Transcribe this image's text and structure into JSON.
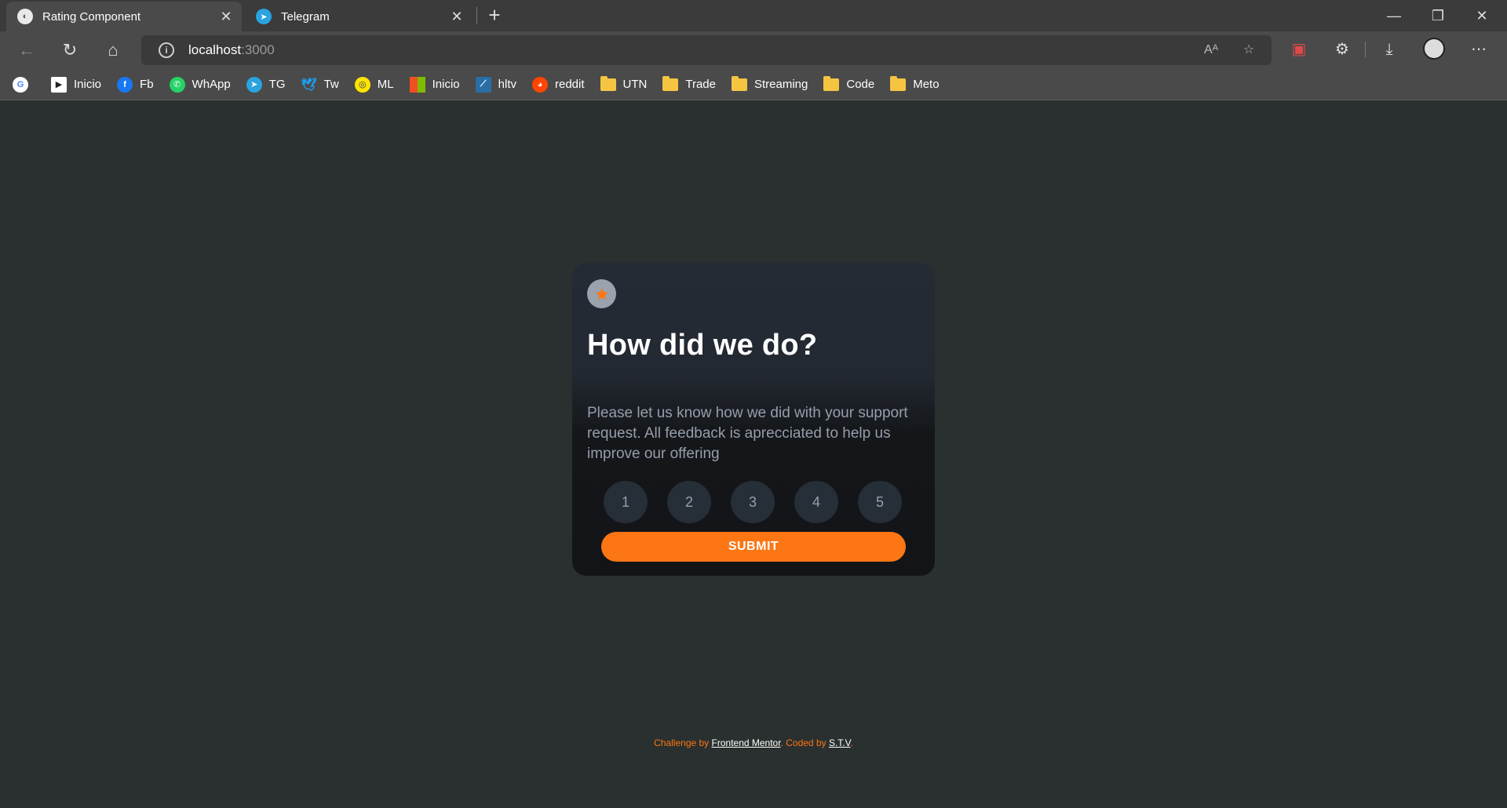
{
  "browser": {
    "tabs": [
      {
        "label": "Rating Component",
        "icon": "globe-icon",
        "active": true
      },
      {
        "label": "Telegram",
        "icon": "telegram-icon",
        "active": false
      }
    ],
    "address": {
      "host": "localhost",
      "port": ":3000"
    },
    "bookmarks": [
      {
        "label": "",
        "icon": "google-icon"
      },
      {
        "label": "Inicio",
        "icon": "play-icon"
      },
      {
        "label": "Fb",
        "icon": "facebook-icon"
      },
      {
        "label": "WhApp",
        "icon": "whatsapp-icon"
      },
      {
        "label": "TG",
        "icon": "telegram-icon"
      },
      {
        "label": "Tw",
        "icon": "twitter-icon"
      },
      {
        "label": "ML",
        "icon": "mercadolibre-icon"
      },
      {
        "label": "Inicio",
        "icon": "microsoft-icon"
      },
      {
        "label": "hltv",
        "icon": "hltv-icon"
      },
      {
        "label": "reddit",
        "icon": "reddit-icon"
      },
      {
        "label": "UTN",
        "icon": "folder-icon"
      },
      {
        "label": "Trade",
        "icon": "folder-icon"
      },
      {
        "label": "Streaming",
        "icon": "folder-icon"
      },
      {
        "label": "Code",
        "icon": "folder-icon"
      },
      {
        "label": "Meto",
        "icon": "folder-icon"
      }
    ]
  },
  "card": {
    "title": "How did we do?",
    "description": "Please let us know how we did with your support request. All feedback is aprecciated to help us improve our offering",
    "ratings": [
      "1",
      "2",
      "3",
      "4",
      "5"
    ],
    "submit_label": "SUBMIT"
  },
  "footer": {
    "challenge_prefix": "Challenge by ",
    "challenge_link": "Frontend Mentor",
    "coded_prefix": ". Coded by ",
    "coded_link": "S.T.V",
    "suffix": "."
  },
  "colors": {
    "page_bg": "#2a302f",
    "accent": "#fc7614",
    "card_bg": "#232932",
    "rating_bg": "#262e38",
    "muted_text": "#959eac"
  }
}
